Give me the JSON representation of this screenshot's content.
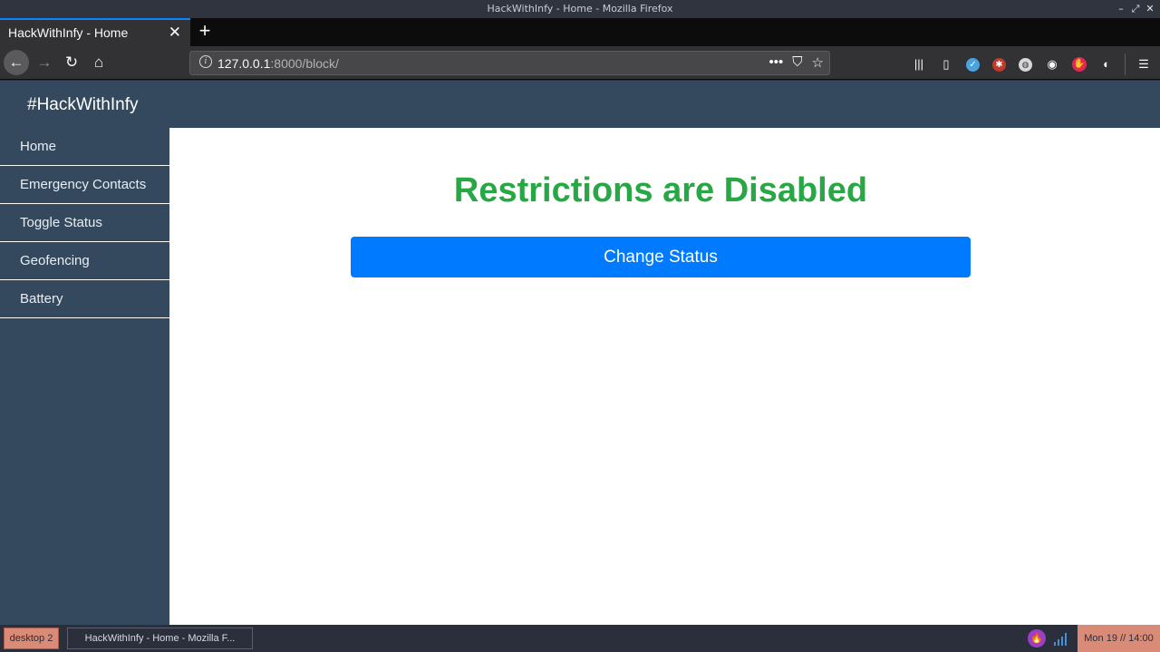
{
  "window": {
    "title": "HackWithInfy - Home - Mozilla Firefox",
    "controls": [
      "–",
      "⤢",
      "✕"
    ]
  },
  "browser": {
    "tab_title": "HackWithInfy - Home",
    "tab_close": "✕",
    "new_tab": "+",
    "url_host": "127.0.0.1",
    "url_rest": ":8000/block/",
    "url_actions": [
      "•••",
      "⛉",
      "☆"
    ]
  },
  "site": {
    "brand": "#HackWithInfy",
    "sidebar": {
      "items": [
        {
          "label": "Home"
        },
        {
          "label": "Emergency Contacts"
        },
        {
          "label": "Toggle Status"
        },
        {
          "label": "Geofencing"
        },
        {
          "label": "Battery"
        }
      ]
    },
    "main": {
      "status_heading": "Restrictions are Disabled",
      "status_color": "#28a745",
      "button_label": "Change Status",
      "button_color": "#007bff"
    }
  },
  "taskbar": {
    "desktop_label": "desktop 2",
    "task_label": "HackWithInfy - Home - Mozilla F...",
    "clock": "Mon 19 // 14:00"
  }
}
